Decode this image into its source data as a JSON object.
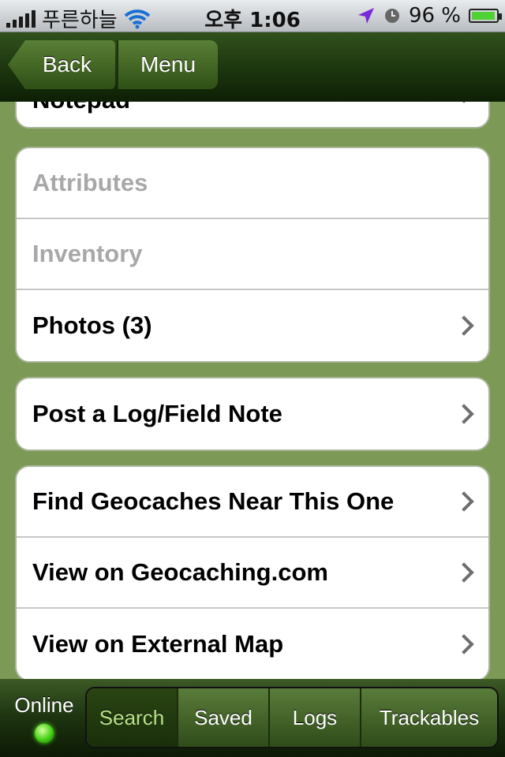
{
  "status": {
    "carrier": "푸른하늘",
    "time": "오후 1:06",
    "battery": "96 %",
    "battery_level": 0.96
  },
  "nav": {
    "back_label": "Back",
    "menu_label": "Menu"
  },
  "groups": {
    "notepad": "Notepad",
    "info": [
      "Attributes",
      "Inventory",
      "Photos (3)"
    ],
    "log": "Post a Log/Field Note",
    "links": [
      "Find Geocaches Near This One",
      "View on Geocaching.com",
      "View on External Map"
    ]
  },
  "tabbar": {
    "online": "Online",
    "tabs": [
      "Search",
      "Saved",
      "Logs",
      "Trackables"
    ],
    "active": "Search"
  },
  "icons": [
    "signal-icon",
    "wifi-icon",
    "location-arrow-icon",
    "alarm-icon",
    "battery-icon",
    "chevron-right-icon",
    "online-led-icon"
  ],
  "colors": {
    "background": "#7c9a55",
    "navbar": "#1f3a10",
    "active_tab_text": "#b8e389",
    "disabled_text": "#a8a8a8"
  }
}
